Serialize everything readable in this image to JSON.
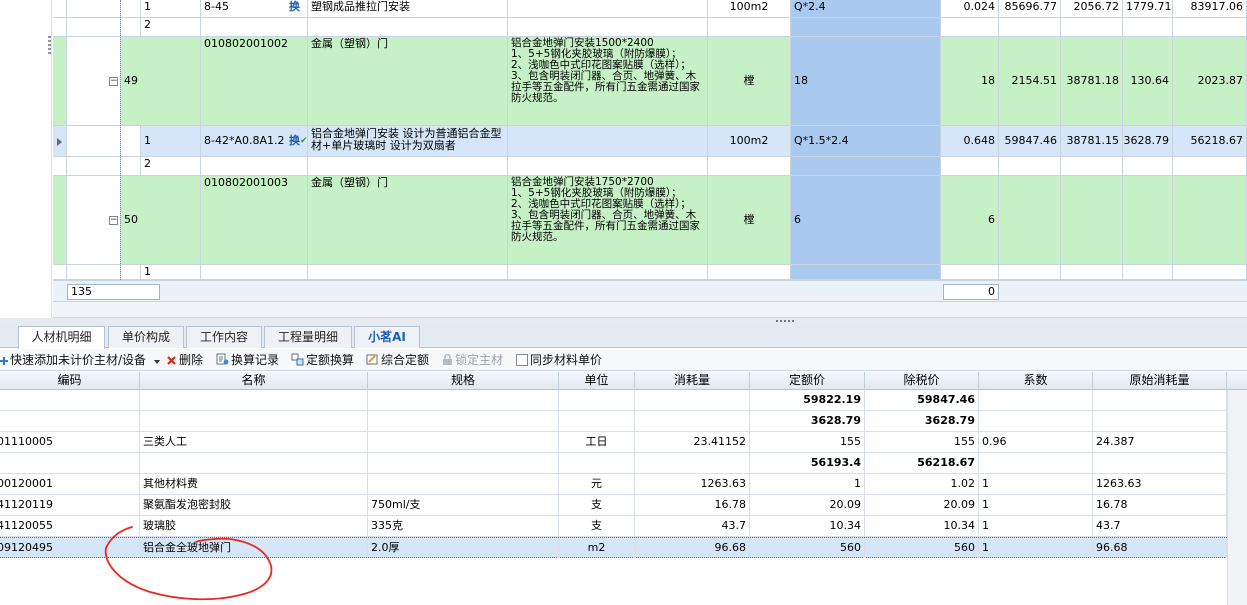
{
  "top_table": {
    "rows": [
      {
        "kind": "sub",
        "color": "white",
        "index": "1",
        "code": "8-45",
        "has_huan": true,
        "name": "塑钢成品推拉门安装",
        "spec": "",
        "unit": "100m2",
        "qty_unit": "",
        "expr": "Q*2.4",
        "qty": "0.024",
        "p1": "85696.77",
        "p2": "2056.72",
        "p3": "1779.71",
        "p4": "83917.06"
      },
      {
        "kind": "sub",
        "color": "white",
        "index": "2",
        "code": "",
        "has_huan": false,
        "name": "",
        "spec": "",
        "unit": "",
        "qty_unit": "",
        "expr": "",
        "qty": "",
        "p1": "",
        "p2": "",
        "p3": "",
        "p4": ""
      },
      {
        "kind": "main",
        "color": "green",
        "seq": "49",
        "code": "010802001002",
        "name": "金属（塑钢）门",
        "spec": "铝合金地弹门安装1500*2400\n1、5+5钢化夹胶玻璃（附防爆膜）；\n2、浅咖色中式印花图案贴膜（选样）；\n3、包含明装闭门器、合页、地弹簧、木拉手等五金配件，所有门五金需通过国家防火规范。",
        "unit": "樘",
        "expr": "18",
        "qty": "18",
        "p1": "2154.51",
        "p2": "38781.18",
        "p3": "130.64",
        "p4": "2023.87"
      },
      {
        "kind": "sub",
        "color": "blue",
        "selected": true,
        "index": "1",
        "code": "8-42*A0.8A1.2",
        "has_huan": true,
        "name": "铝合金地弹门安装  设计为普通铝合金型材+单片玻璃时  设计为双扇者",
        "spec": "",
        "unit": "100m2",
        "expr": "Q*1.5*2.4",
        "qty": "0.648",
        "p1": "59847.46",
        "p2": "38781.15",
        "p3": "3628.79",
        "p4": "56218.67"
      },
      {
        "kind": "sub",
        "color": "white",
        "index": "2",
        "code": "",
        "has_huan": false,
        "name": "",
        "spec": "",
        "unit": "",
        "expr": "",
        "qty": "",
        "p1": "",
        "p2": "",
        "p3": "",
        "p4": ""
      },
      {
        "kind": "main",
        "color": "green",
        "seq": "50",
        "code": "010802001003",
        "name": "金属（塑钢）门",
        "spec": "铝合金地弹门安装1750*2700\n1、5+5钢化夹胶玻璃（附防爆膜）；\n2、浅咖色中式印花图案贴膜（选样）；\n3、包含明装闭门器、合页、地弹簧、木拉手等五金配件，所有门五金需通过国家防火规范。",
        "unit": "樘",
        "expr": "6",
        "qty": "6",
        "p1": "",
        "p2": "",
        "p3": "",
        "p4": ""
      },
      {
        "kind": "sub",
        "color": "white",
        "index": "1",
        "code": "",
        "has_huan": false,
        "name": "",
        "spec": "",
        "unit": "",
        "expr": "",
        "qty": "",
        "p1": "",
        "p2": "",
        "p3": "",
        "p4": ""
      }
    ],
    "footer": {
      "count": "135",
      "total": "0"
    }
  },
  "tabs": [
    {
      "label": "人材机明细",
      "active": true
    },
    {
      "label": "单价构成",
      "active": false
    },
    {
      "label": "工作内容",
      "active": false
    },
    {
      "label": "工程量明细",
      "active": false
    },
    {
      "label": "小茗AI",
      "active": false,
      "ai": true
    }
  ],
  "toolbar": {
    "quick_add": "快速添加未计价主材/设备",
    "delete": "删除",
    "swap_record": "换算记录",
    "quota_swap": "定额换算",
    "composite": "综合定额",
    "lock_main": "锁定主材",
    "sync_price": "同步材料单价"
  },
  "detail_table": {
    "headers": [
      "编码",
      "名称",
      "规格",
      "单位",
      "消耗量",
      "定额价",
      "除税价",
      "系数",
      "原始消耗量"
    ],
    "rows": [
      {
        "code": "",
        "name": "",
        "spec": "",
        "unit": "",
        "consume": "",
        "quota": "59822.19",
        "tax": "59847.46",
        "coef": "",
        "orig": "",
        "bold": true
      },
      {
        "code": "",
        "name": "",
        "spec": "",
        "unit": "",
        "consume": "",
        "quota": "3628.79",
        "tax": "3628.79",
        "coef": "",
        "orig": "",
        "bold": true
      },
      {
        "code": "01110005",
        "name": "三类人工",
        "spec": "",
        "unit": "工日",
        "consume": "23.41152",
        "quota": "155",
        "tax": "155",
        "coef": "0.96",
        "orig": "24.387"
      },
      {
        "code": "",
        "name": "",
        "spec": "",
        "unit": "",
        "consume": "",
        "quota": "56193.4",
        "tax": "56218.67",
        "coef": "",
        "orig": "",
        "bold": true
      },
      {
        "code": "00120001",
        "name": "其他材料费",
        "spec": "",
        "unit": "元",
        "consume": "1263.63",
        "quota": "1",
        "tax": "1.02",
        "coef": "1",
        "orig": "1263.63"
      },
      {
        "code": "41120119",
        "name": "聚氨酯发泡密封胶",
        "spec": "750ml/支",
        "unit": "支",
        "consume": "16.78",
        "quota": "20.09",
        "tax": "20.09",
        "coef": "1",
        "orig": "16.78"
      },
      {
        "code": "41120055",
        "name": "玻璃胶",
        "spec": "335克",
        "unit": "支",
        "consume": "43.7",
        "quota": "10.34",
        "tax": "10.34",
        "coef": "1",
        "orig": "43.7"
      },
      {
        "code": "09120495",
        "name": "铝合金全玻地弹门",
        "spec": "2.0厚",
        "unit": "m2",
        "consume": "96.68",
        "quota": "560",
        "tax": "560",
        "coef": "1",
        "orig": "96.68",
        "selected": true
      }
    ]
  },
  "colors": {
    "green_row": "#c6f0c6",
    "blue_row": "#d4e6f7",
    "selected_col": "#a9c9ee",
    "annotation": "#e8281e",
    "ai_tab": "#1a5fb4"
  },
  "icons": [
    "huan-icon",
    "collapse-icon",
    "row-pointer-icon",
    "add-icon",
    "delete-icon",
    "swap-record-icon",
    "quota-swap-icon",
    "composite-icon",
    "lock-icon",
    "checkbox-icon",
    "dropdown-icon"
  ]
}
